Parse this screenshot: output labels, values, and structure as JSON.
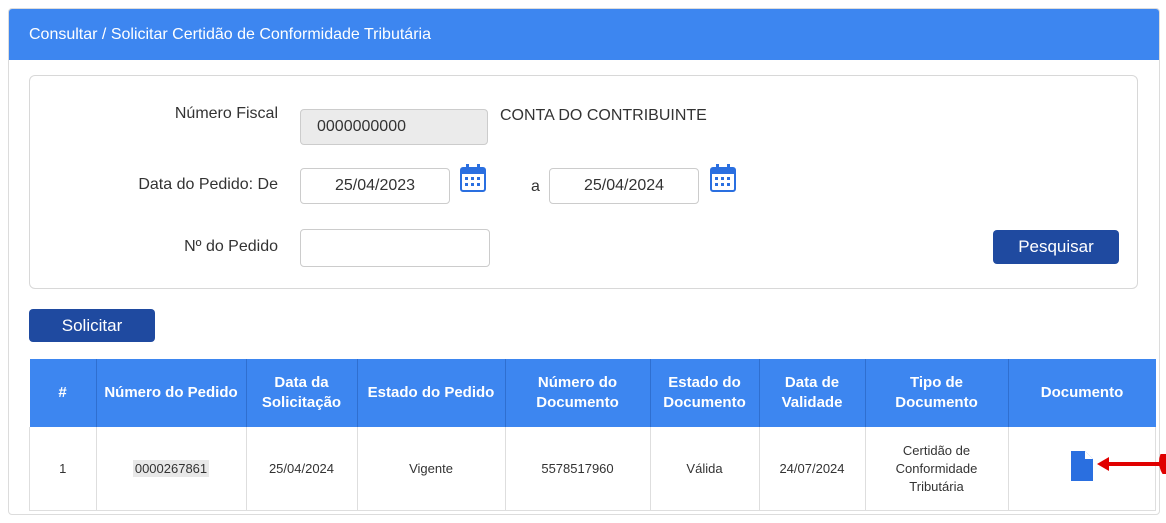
{
  "header": {
    "title": "Consultar / Solicitar Certidão de Conformidade Tributária"
  },
  "filters": {
    "fiscal_label": "Número Fiscal",
    "fiscal_value": "0000000000",
    "fiscal_name": "CONTA DO CONTRIBUINTE",
    "date_label": "Data do Pedido: De",
    "date_from": "25/04/2023",
    "date_sep": "a",
    "date_to": "25/04/2024",
    "order_label": "Nº do Pedido",
    "order_value": "",
    "search_label": "Pesquisar"
  },
  "actions": {
    "request_label": "Solicitar"
  },
  "table": {
    "headers": [
      "#",
      "Número do Pedido",
      "Data da Solicitação",
      "Estado do Pedido",
      "Número do Documento",
      "Estado do Documento",
      "Data de Validade",
      "Tipo de Documento",
      "Documento"
    ],
    "rows": [
      {
        "index": "1",
        "order_number": "0000267861",
        "request_date": "25/04/2024",
        "order_state": "Vigente",
        "document_number": "5578517960",
        "document_state": "Válida",
        "validity_date": "24/07/2024",
        "document_type": "Certidão de Conformidade Tributária",
        "document_icon": "file-icon"
      }
    ]
  },
  "colors": {
    "header_blue": "#3d86f0",
    "button_navy": "#1f4aa0",
    "annotation_red": "#e00000"
  }
}
